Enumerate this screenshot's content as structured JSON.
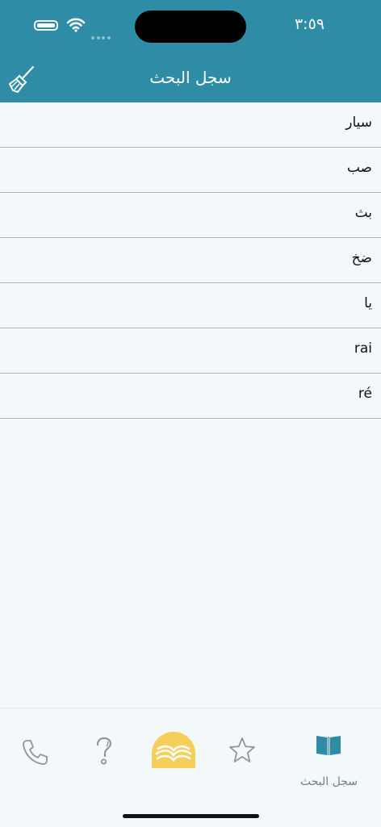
{
  "status_bar": {
    "time": "٣:٥٩"
  },
  "header": {
    "title": "سجل البحث",
    "clear_icon": "broom-icon"
  },
  "history": [
    {
      "text": "سيار"
    },
    {
      "text": "صب"
    },
    {
      "text": "بث"
    },
    {
      "text": "ضخ"
    },
    {
      "text": "يا"
    },
    {
      "text": "rai"
    },
    {
      "text": "ré"
    }
  ],
  "tabs": [
    {
      "name": "phone",
      "icon": "phone-icon"
    },
    {
      "name": "help",
      "icon": "question-icon"
    },
    {
      "name": "dictionary",
      "icon": "book-logo-icon"
    },
    {
      "name": "favorites",
      "icon": "star-icon"
    },
    {
      "name": "history",
      "icon": "open-book-icon",
      "label": "سجل البحث",
      "active": true
    }
  ],
  "colors": {
    "accent": "#2e8ca6",
    "logo": "#f5cf5a",
    "background": "#f3f8fb"
  }
}
